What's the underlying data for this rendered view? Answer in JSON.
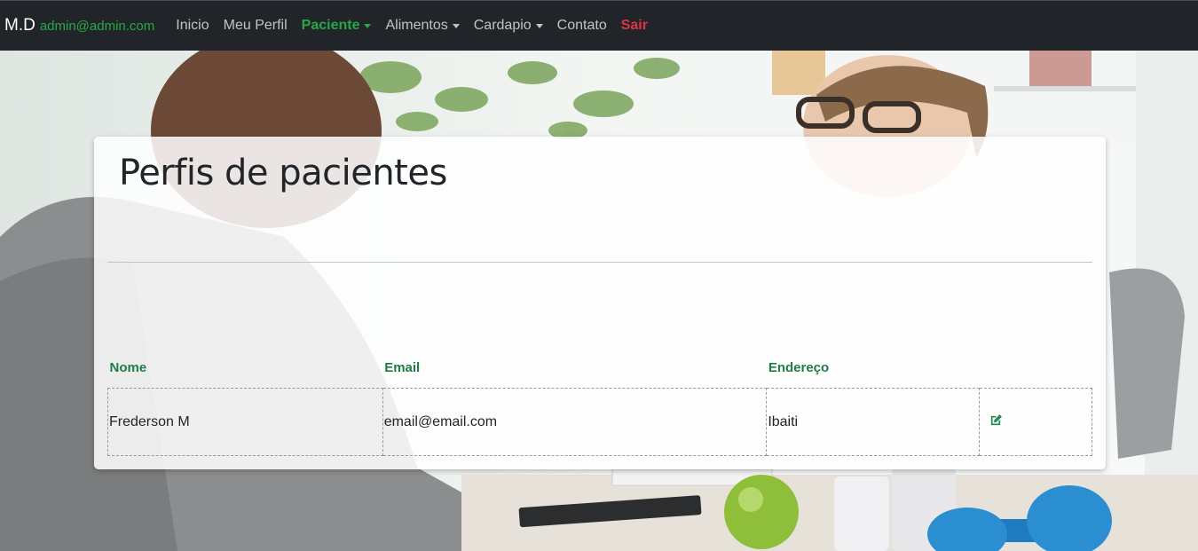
{
  "navbar": {
    "brand": "M.D",
    "user_email": "admin@admin.com",
    "items": [
      {
        "label": "Inicio"
      },
      {
        "label": "Meu Perfil"
      },
      {
        "label": "Paciente"
      },
      {
        "label": "Alimentos"
      },
      {
        "label": "Cardapio"
      },
      {
        "label": "Contato"
      },
      {
        "label": "Sair"
      }
    ],
    "active_item": "Paciente"
  },
  "main": {
    "title": "Perfis de pacientes",
    "table": {
      "columns": [
        "Nome",
        "Email",
        "Endereço",
        ""
      ],
      "rows": [
        {
          "name": "Frederson M",
          "email": "email@email.com",
          "address": "Ibaiti",
          "action_icon": "edit-icon"
        }
      ]
    }
  },
  "colors": {
    "navbar_bg": "#212529",
    "accent_green": "#28a745",
    "logout_red": "#dc3545",
    "header_green": "#1e7e45"
  }
}
